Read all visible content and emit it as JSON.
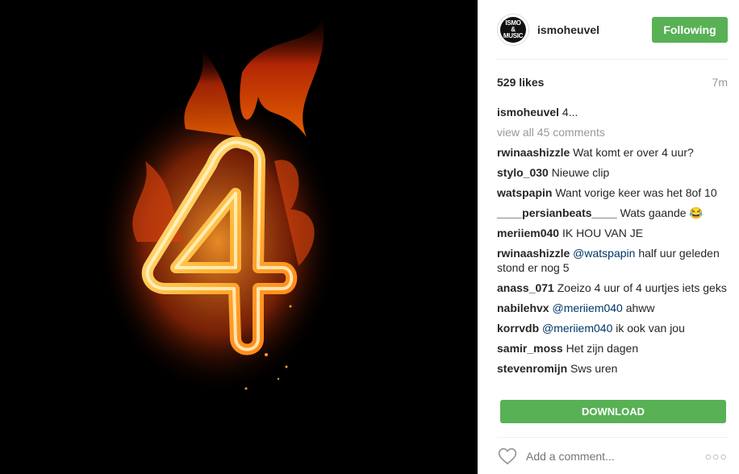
{
  "post": {
    "username": "ismoheuvel",
    "avatar_line1": "ISMO",
    "avatar_line2": "&",
    "avatar_line3": "MUSIC",
    "follow_label": "Following",
    "likes": "529 likes",
    "time": "7m",
    "caption_user": "ismoheuvel",
    "caption_text": "4...",
    "view_all": "view all 45 comments",
    "image_digit": "4"
  },
  "comments": [
    {
      "user": "rwinaashizzle",
      "mention": "",
      "text": "Wat komt er over 4 uur?"
    },
    {
      "user": "stylo_030",
      "mention": "",
      "text": "Nieuwe clip"
    },
    {
      "user": "watspapin",
      "mention": "",
      "text": "Want vorige keer was het 8of 10"
    },
    {
      "user": "____persianbeats____",
      "mention": "",
      "text": "Wats gaande 😂"
    },
    {
      "user": "meriiem040",
      "mention": "",
      "text": "IK HOU VAN JE"
    },
    {
      "user": "rwinaashizzle",
      "mention": "@watspapin",
      "text": "half uur geleden stond er nog 5"
    },
    {
      "user": "anass_071",
      "mention": "",
      "text": "Zoeizo 4 uur of 4 uurtjes iets geks"
    },
    {
      "user": "nabilehvx",
      "mention": "@meriiem040",
      "text": "ahww"
    },
    {
      "user": "korrvdb",
      "mention": "@meriiem040",
      "text": "ik ook van jou"
    },
    {
      "user": "samir_moss",
      "mention": "",
      "text": "Het zijn dagen"
    },
    {
      "user": "stevenromijn",
      "mention": "",
      "text": "Sws uren"
    }
  ],
  "download_label": "DOWNLOAD",
  "add_comment_placeholder": "Add a comment...",
  "more_label": "○○○",
  "colors": {
    "accent": "#58b155",
    "mention": "#003569",
    "muted": "#999999"
  },
  "icons": {
    "heart": "heart-icon",
    "more": "more-options-icon"
  }
}
